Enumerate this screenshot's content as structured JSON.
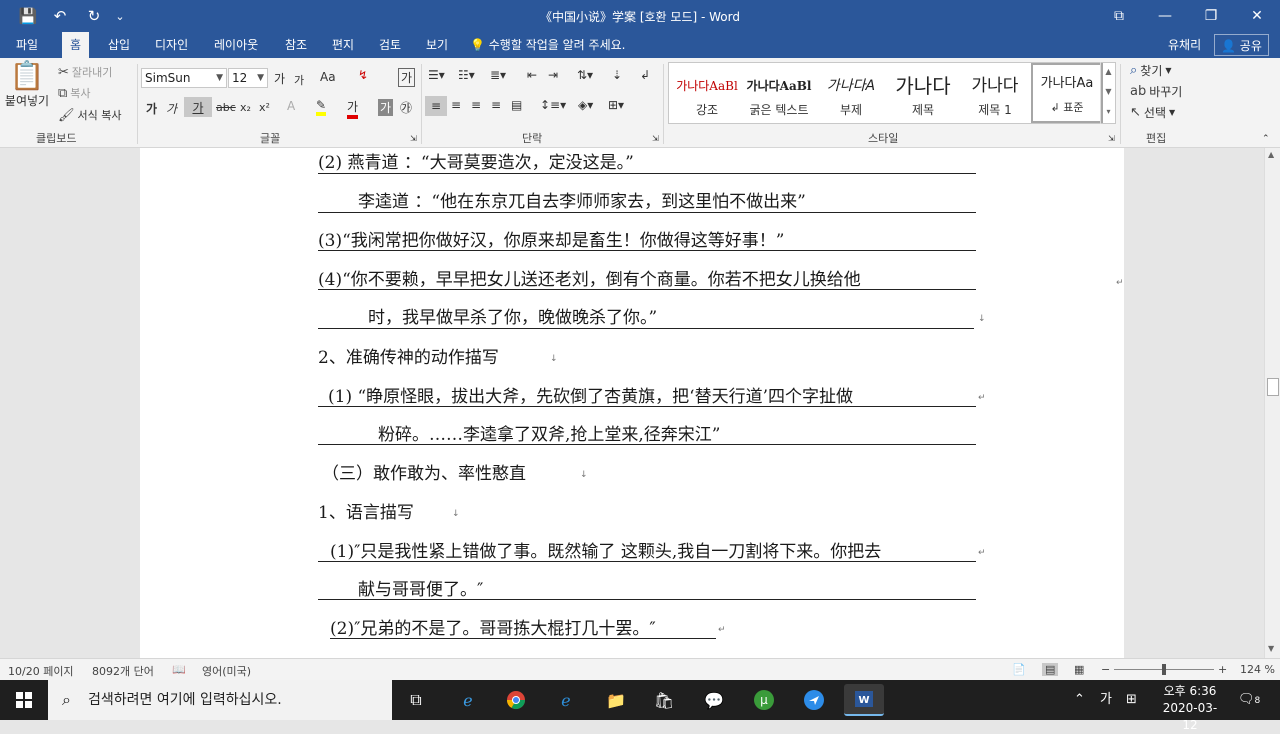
{
  "window": {
    "title": "《中国小说》学案 [호환 모드] - Word",
    "controls": {
      "restore_ribbon": "⧉",
      "minimize": "—",
      "maximize": "❐",
      "close": "✕"
    }
  },
  "quick_access": {
    "save": "💾",
    "undo": "↶",
    "redo": "↻",
    "more": "⌄"
  },
  "ribbon_tabs": [
    "파일",
    "홈",
    "삽입",
    "디자인",
    "레이아웃",
    "참조",
    "편지",
    "검토",
    "보기"
  ],
  "active_tab": "홈",
  "tell_me": "수행할 작업을 알려 주세요.",
  "user_name": "유채리",
  "share_label": "공유",
  "clipboard": {
    "paste": "붙여넣기",
    "cut": "잘라내기",
    "copy": "복사",
    "format_painter": "서식 복사",
    "group": "클립보드"
  },
  "font": {
    "name": "SimSun",
    "size": "12",
    "grow": "가",
    "shrink": "가",
    "case": "Aa",
    "bold": "가",
    "italic": "가",
    "underline": "가",
    "strike": "abc",
    "subscript": "x₂",
    "superscript": "x²",
    "group": "글꼴"
  },
  "paragraph": {
    "group": "단락"
  },
  "styles": {
    "group": "스타일",
    "items": [
      {
        "sample": "가나다AaBl",
        "name": "강조"
      },
      {
        "sample": "가나다AaBl",
        "name": "굵은 텍스트"
      },
      {
        "sample": "가나다A",
        "name": "부제"
      },
      {
        "sample": "가나다",
        "name": "제목"
      },
      {
        "sample": "가나다",
        "name": "제목 1"
      },
      {
        "sample": "가나다Aa",
        "name": "표준"
      }
    ]
  },
  "editing": {
    "group": "편집",
    "find": "찾기",
    "replace": "바꾸기",
    "select": "선택"
  },
  "document_lines": [
    "(2) 燕青道 ：“大哥莫要造次，定没这是。”",
    "李逵道 ：“他在东京兀自去李师师家去，到这里怕不做出来”",
    "(3)“我闲常把你做好汉，你原来却是畜生！你做得这等好事！”",
    "(4)“你不要赖，早早把女儿送还老刘，倒有个商量。你若不把女儿换给他",
    "时，我早做早杀了你，晚做晚杀了你。”",
    "2、准确传神的动作描写",
    "(1) “睁原怪眼，拔出大斧，先砍倒了杏黄旗，把‘替天行道’四个字扯做",
    "粉碎。……李逵拿了双斧,抢上堂来,径奔宋江”",
    "（三）敢作敢为、率性憨直",
    "1、语言描写",
    "(1)″只是我性紧上错做了事。既然输了 这颗头,我自一刀割将下来。你把去",
    "献与哥哥便了。″",
    "(2)″兄弟的不是了。哥哥拣大棍打几十罢。″"
  ],
  "status_bar": {
    "page": "10/20 페이지",
    "words": "8092개 단어",
    "language": "영어(미국)",
    "zoom": "124 %",
    "zoom_level": 0.5
  },
  "taskbar": {
    "search_placeholder": "검색하려면 여기에 입력하십시오.",
    "ime": "가",
    "time": "오후 6:36",
    "date": "2020-03-12",
    "notifications": "8"
  }
}
